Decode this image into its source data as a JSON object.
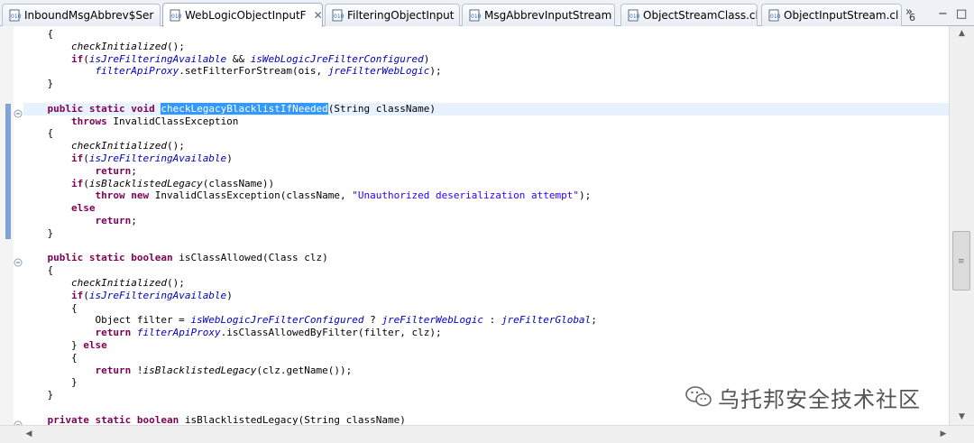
{
  "tabs": [
    {
      "label": "InboundMsgAbbrev$Ser",
      "active": false,
      "closable": false
    },
    {
      "label": "WebLogicObjectInputF",
      "active": true,
      "closable": true
    },
    {
      "label": "FilteringObjectInput",
      "active": false,
      "closable": false
    },
    {
      "label": "MsgAbbrevInputStream",
      "active": false,
      "closable": false
    },
    {
      "label": "ObjectStreamClass.cl",
      "active": false,
      "closable": false
    },
    {
      "label": "ObjectInputStream.cl",
      "active": false,
      "closable": false
    }
  ],
  "overflow": {
    "symbol": "»",
    "count": "6"
  },
  "window_controls": {
    "minimize": "−",
    "maximize": "□"
  },
  "icons": {
    "tab": "class-file-icon",
    "fold": "fold-collapse-icon",
    "scroll_up": "arrow-up-icon",
    "scroll_down": "arrow-down-icon",
    "scroll_left": "arrow-left-icon",
    "scroll_right": "arrow-right-icon",
    "watermark": "wechat-logo-icon"
  },
  "colors": {
    "keyword": "#7f0055",
    "field": "#0000c0",
    "string": "#2a00ff",
    "selection": "#3399ff",
    "current_line": "#e8f2fe"
  },
  "code_lines": [
    [
      {
        "t": "    {"
      }
    ],
    [
      {
        "t": "        "
      },
      {
        "t": "checkInitialized",
        "c": "it"
      },
      {
        "t": "();"
      }
    ],
    [
      {
        "t": "        "
      },
      {
        "t": "if",
        "c": "kw"
      },
      {
        "t": "("
      },
      {
        "t": "isJreFilteringAvailable",
        "c": "fld"
      },
      {
        "t": " && "
      },
      {
        "t": "isWebLogicJreFilterConfigured",
        "c": "fld"
      },
      {
        "t": ")"
      }
    ],
    [
      {
        "t": "            "
      },
      {
        "t": "filterApiProxy",
        "c": "fld"
      },
      {
        "t": ".setFilterForStream(ois, "
      },
      {
        "t": "jreFilterWebLogic",
        "c": "fld"
      },
      {
        "t": ");"
      }
    ],
    [
      {
        "t": "    }"
      }
    ],
    [
      {
        "t": ""
      }
    ],
    [
      {
        "t": "    "
      },
      {
        "t": "public",
        "c": "kw"
      },
      {
        "t": " "
      },
      {
        "t": "static",
        "c": "kw"
      },
      {
        "t": " "
      },
      {
        "t": "void",
        "c": "kw"
      },
      {
        "t": " "
      },
      {
        "t": "checkLegacyBlacklistIfNeeded",
        "c": "sel"
      },
      {
        "t": "(String className)"
      }
    ],
    [
      {
        "t": "        "
      },
      {
        "t": "throws",
        "c": "kw"
      },
      {
        "t": " InvalidClassException"
      }
    ],
    [
      {
        "t": "    {"
      }
    ],
    [
      {
        "t": "        "
      },
      {
        "t": "checkInitialized",
        "c": "it"
      },
      {
        "t": "();"
      }
    ],
    [
      {
        "t": "        "
      },
      {
        "t": "if",
        "c": "kw"
      },
      {
        "t": "("
      },
      {
        "t": "isJreFilteringAvailable",
        "c": "fld"
      },
      {
        "t": ")"
      }
    ],
    [
      {
        "t": "            "
      },
      {
        "t": "return",
        "c": "kw"
      },
      {
        "t": ";"
      }
    ],
    [
      {
        "t": "        "
      },
      {
        "t": "if",
        "c": "kw"
      },
      {
        "t": "("
      },
      {
        "t": "isBlacklistedLegacy",
        "c": "it"
      },
      {
        "t": "(className))"
      }
    ],
    [
      {
        "t": "            "
      },
      {
        "t": "throw",
        "c": "kw"
      },
      {
        "t": " "
      },
      {
        "t": "new",
        "c": "kw"
      },
      {
        "t": " InvalidClassException(className, "
      },
      {
        "t": "\"Unauthorized deserialization attempt\"",
        "c": "str"
      },
      {
        "t": ");"
      }
    ],
    [
      {
        "t": "        "
      },
      {
        "t": "else",
        "c": "kw"
      }
    ],
    [
      {
        "t": "            "
      },
      {
        "t": "return",
        "c": "kw"
      },
      {
        "t": ";"
      }
    ],
    [
      {
        "t": "    }"
      }
    ],
    [
      {
        "t": ""
      }
    ],
    [
      {
        "t": "    "
      },
      {
        "t": "public",
        "c": "kw"
      },
      {
        "t": " "
      },
      {
        "t": "static",
        "c": "kw"
      },
      {
        "t": " "
      },
      {
        "t": "boolean",
        "c": "kw"
      },
      {
        "t": " isClassAllowed(Class clz)"
      }
    ],
    [
      {
        "t": "    {"
      }
    ],
    [
      {
        "t": "        "
      },
      {
        "t": "checkInitialized",
        "c": "it"
      },
      {
        "t": "();"
      }
    ],
    [
      {
        "t": "        "
      },
      {
        "t": "if",
        "c": "kw"
      },
      {
        "t": "("
      },
      {
        "t": "isJreFilteringAvailable",
        "c": "fld"
      },
      {
        "t": ")"
      }
    ],
    [
      {
        "t": "        {"
      }
    ],
    [
      {
        "t": "            Object filter = "
      },
      {
        "t": "isWebLogicJreFilterConfigured",
        "c": "fld"
      },
      {
        "t": " ? "
      },
      {
        "t": "jreFilterWebLogic",
        "c": "fld"
      },
      {
        "t": " : "
      },
      {
        "t": "jreFilterGlobal",
        "c": "fld"
      },
      {
        "t": ";"
      }
    ],
    [
      {
        "t": "            "
      },
      {
        "t": "return",
        "c": "kw"
      },
      {
        "t": " "
      },
      {
        "t": "filterApiProxy",
        "c": "fld"
      },
      {
        "t": ".isClassAllowedByFilter(filter, clz);"
      }
    ],
    [
      {
        "t": "        } "
      },
      {
        "t": "else",
        "c": "kw"
      }
    ],
    [
      {
        "t": "        {"
      }
    ],
    [
      {
        "t": "            "
      },
      {
        "t": "return",
        "c": "kw"
      },
      {
        "t": " !"
      },
      {
        "t": "isBlacklistedLegacy",
        "c": "it"
      },
      {
        "t": "(clz.getName());"
      }
    ],
    [
      {
        "t": "        }"
      }
    ],
    [
      {
        "t": "    }"
      }
    ],
    [
      {
        "t": ""
      }
    ],
    [
      {
        "t": "    "
      },
      {
        "t": "private",
        "c": "kw"
      },
      {
        "t": " "
      },
      {
        "t": "static",
        "c": "kw"
      },
      {
        "t": " "
      },
      {
        "t": "boolean",
        "c": "kw"
      },
      {
        "t": " isBlacklistedLegacy(String className)"
      }
    ]
  ],
  "highlighted_line_index": 6,
  "fold_line_indices": [
    6,
    18,
    31
  ],
  "watermark": {
    "text": "乌托邦安全技术社区"
  }
}
